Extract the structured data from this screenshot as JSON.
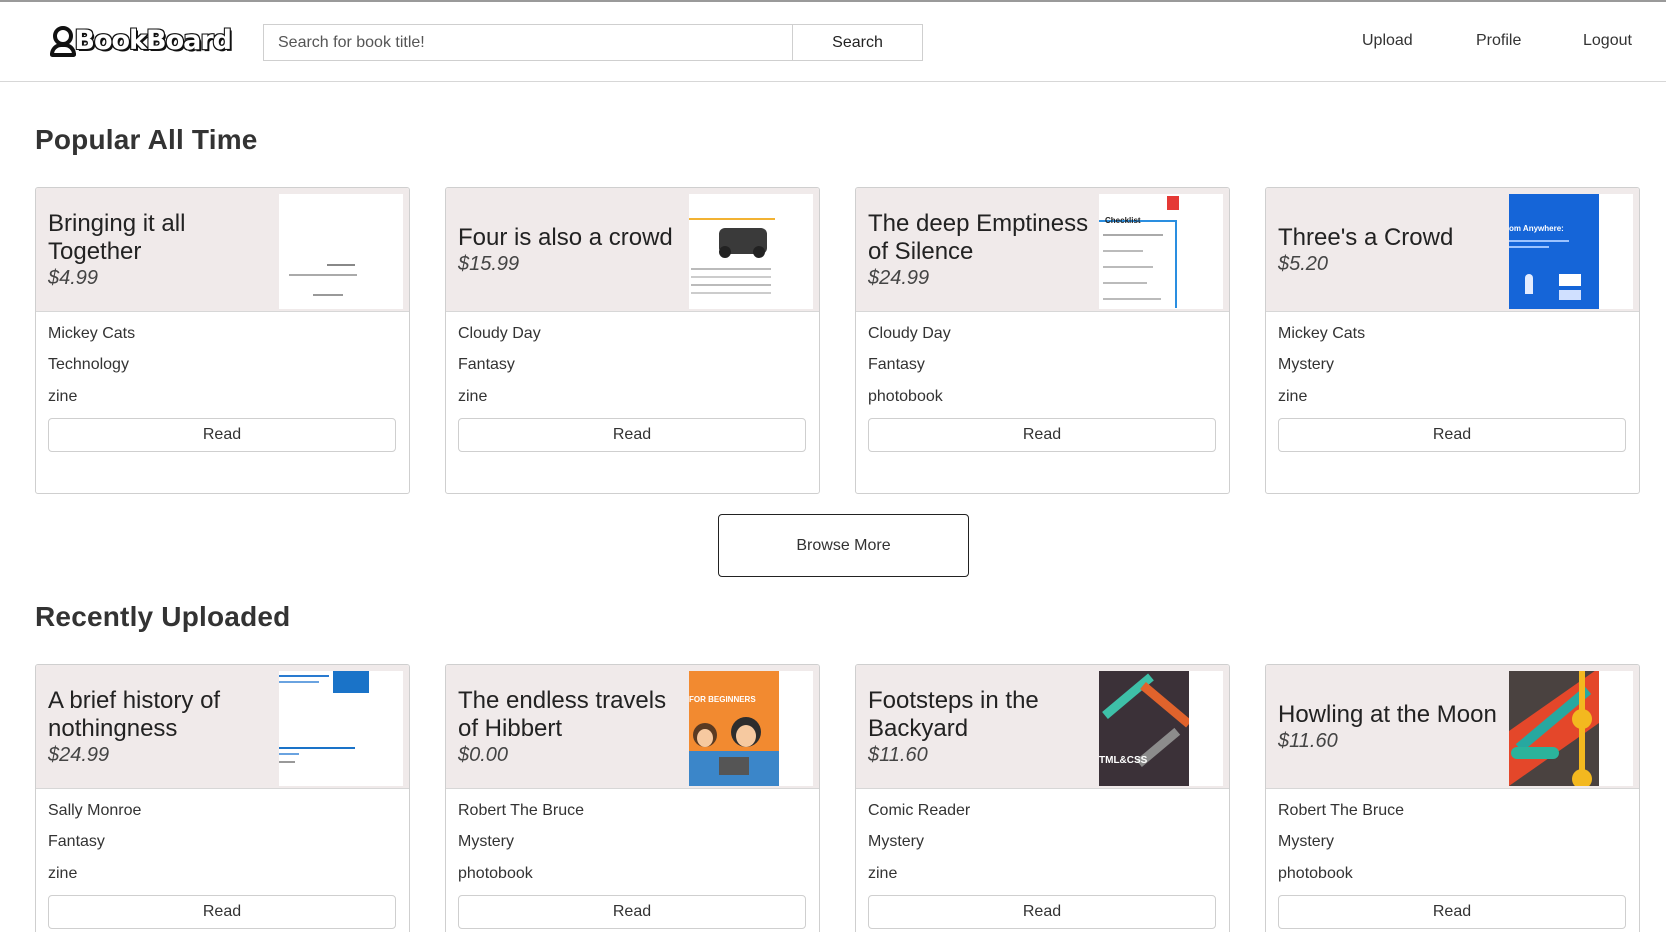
{
  "header": {
    "logo_text": "BookBoard",
    "search_placeholder": "Search for book title!",
    "search_button": "Search",
    "nav": {
      "upload": "Upload",
      "profile": "Profile",
      "logout": "Logout"
    }
  },
  "popular": {
    "title": "Popular All Time",
    "books": [
      {
        "title": "Bringing it all Together",
        "price": "$4.99",
        "author": "Mickey Cats",
        "genre": "Technology",
        "type": "zine",
        "read": "Read"
      },
      {
        "title": "Four is also a crowd",
        "price": "$15.99",
        "author": "Cloudy Day",
        "genre": "Fantasy",
        "type": "zine",
        "read": "Read"
      },
      {
        "title": "The deep Emptiness of Silence",
        "price": "$24.99",
        "author": "Cloudy Day",
        "genre": "Fantasy",
        "type": "photobook",
        "read": "Read"
      },
      {
        "title": "Three's a Crowd",
        "price": "$5.20",
        "author": "Mickey Cats",
        "genre": "Mystery",
        "type": "zine",
        "read": "Read"
      }
    ]
  },
  "browse_more": "Browse More",
  "recent": {
    "title": "Recently Uploaded",
    "books": [
      {
        "title": "A brief history of nothingness",
        "price": "$24.99",
        "author": "Sally Monroe",
        "genre": "Fantasy",
        "type": "zine",
        "read": "Read"
      },
      {
        "title": "The endless travels of Hibbert",
        "price": "$0.00",
        "author": "Robert The Bruce",
        "genre": "Mystery",
        "type": "photobook",
        "read": "Read"
      },
      {
        "title": "Footsteps in the Backyard",
        "price": "$11.60",
        "author": "Comic Reader",
        "genre": "Mystery",
        "type": "zine",
        "read": "Read"
      },
      {
        "title": "Howling at the Moon",
        "price": "$11.60",
        "author": "Robert The Bruce",
        "genre": "Mystery",
        "type": "photobook",
        "read": "Read"
      }
    ]
  },
  "thumb_text": {
    "checklist": "Checklist",
    "anywhere": "om Anywhere:",
    "beginners": "FOR BEGINNERS",
    "htmlcss": "TML&CSS"
  }
}
